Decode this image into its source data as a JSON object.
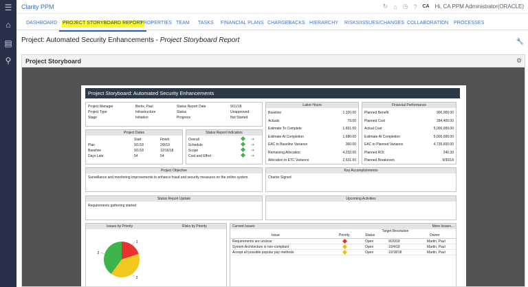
{
  "app": {
    "title": "Clarity PPM",
    "user": "Hi, CA PPM Administrator(ORACLE)",
    "avatar": "CA"
  },
  "nav": {
    "tabs": [
      "DASHBOARD",
      "PROJECT STORYBOARD REPORT",
      "PROPERTIES",
      "TEAM",
      "TASKS",
      "FINANCIAL PLANS",
      "CHARGEBACKS",
      "HIERARCHY",
      "RISKS/ISSUES/CHANGES",
      "COLLABORATION",
      "PROCESSES"
    ],
    "active": "PROJECT STORYBOARD REPORT"
  },
  "page": {
    "title_prefix": "Project: Automated Security Enhancements - ",
    "title_italic": "Project Storyboard Report"
  },
  "panel": {
    "title": "Project Storyboard"
  },
  "report": {
    "title": "Project Storyboard:  Automated Security Enhancements",
    "info": {
      "project_manager_label": "Project Manager",
      "project_manager": "Berks, Paul",
      "project_type_label": "Project Type",
      "project_type": "Infrastructure",
      "stage_label": "Stage",
      "stage": "Initiation",
      "status_date_label": "Status Report Date",
      "status_date": "9/11/18",
      "status_label": "Status",
      "status": "Unapproved",
      "progress_label": "Progress",
      "progress": "Not Started"
    },
    "dates": {
      "header": "Project Dates",
      "col_start": "Start",
      "col_finish": "Finish",
      "plan_label": "Plan",
      "plan_start": "9/1/18",
      "plan_finish": "2/8/19",
      "baseline_label": "Baseline",
      "baseline_start": "9/1/18",
      "baseline_finish": "12/16/18",
      "late_label": "Days Late",
      "late_start": "54",
      "late_finish": "54"
    },
    "indicators": {
      "header": "Status Report Indicators",
      "items": [
        "Overall",
        "Schedule",
        "Scope",
        "Cost and Effort"
      ]
    },
    "labor": {
      "header": "Labor Hours",
      "rows": [
        [
          "Baseline",
          "1,320.00"
        ],
        [
          "Actuals",
          "79.00"
        ],
        [
          "Estimate To Complete",
          "1,601.00"
        ],
        [
          "Estimate At Completion",
          "1,680.00"
        ],
        [
          "EAC to Baseline Variance",
          "360.00"
        ],
        [
          "Remaining Allocation",
          "4,232.00"
        ],
        [
          "Allocation to ETC Variance",
          "2,631.00"
        ]
      ]
    },
    "finance": {
      "header": "Financial Performance",
      "rows": [
        [
          "Planned Benefit",
          "900,000.00"
        ],
        [
          "Planned Cost",
          "284,400.00"
        ],
        [
          "Actual Cost",
          "5,000,000.00"
        ],
        [
          "Estimate At Completion",
          "5,000,000.00"
        ],
        [
          "EAC to Planned Variance",
          "4,735,600.00"
        ],
        [
          "Planned ROI",
          "240.39"
        ],
        [
          "Planned Breakeven",
          "9/30/18"
        ]
      ]
    },
    "objective": {
      "header": "Project Objective",
      "text": "Surveillance and monitoring improvements to enhance fraud and security measures on the online system."
    },
    "accomplishments": {
      "header": "Key Accomplishments",
      "text": "Charter Signed"
    },
    "status_update": {
      "header": "Status Report Update",
      "text": "Requirements gathering started"
    },
    "upcoming": {
      "header": "Upcoming Activities",
      "text": ""
    },
    "issues_chart": {
      "header": "Issues by Priority"
    },
    "risks_chart": {
      "header": "Risks by Priority"
    },
    "current_issues": {
      "header": "Current Issues",
      "more": "More Issues...",
      "col_issue": "Issue",
      "col_priority": "Priority",
      "col_status": "Status",
      "col_target": "Target Resolution",
      "col_owner": "Owner",
      "rows": [
        {
          "issue": "Requirements are unclear",
          "priority": "red",
          "status": "Open",
          "target": "9/20/18",
          "owner": "Martin, Paul"
        },
        {
          "issue": "System Architecture is non-compliant",
          "priority": "yellow",
          "status": "Open",
          "target": "10/4/18",
          "owner": "Martin, Paul"
        },
        {
          "issue": "Accept all possible popular pay methods",
          "priority": "yellow",
          "status": "Open",
          "target": "10/18/18",
          "owner": "Martin, Paul"
        }
      ]
    }
  },
  "chart_data": {
    "type": "pie",
    "title": "Issues by Priority",
    "labels": [
      "1",
      "2",
      "2"
    ],
    "values": [
      1,
      2,
      2
    ],
    "colors": [
      "#e8342c",
      "#f2c81f",
      "#3db44a"
    ]
  }
}
